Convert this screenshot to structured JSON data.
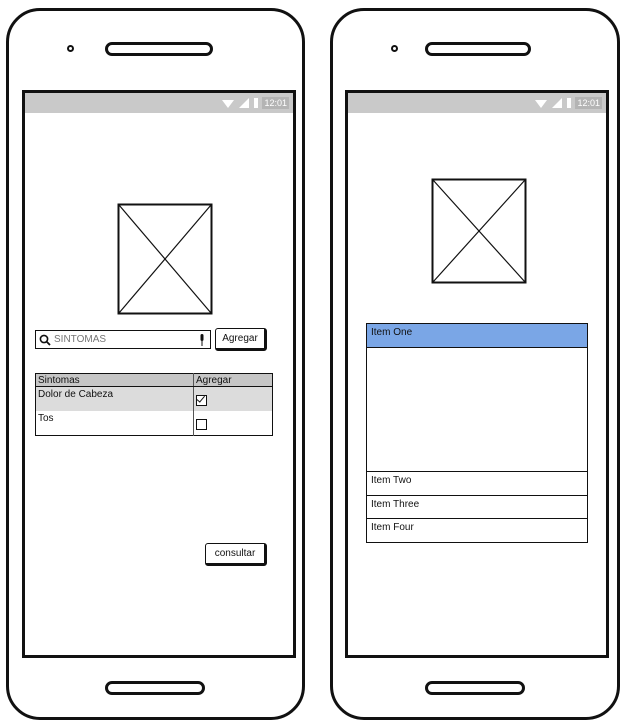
{
  "phone1": {
    "status_time": "12:01",
    "search": {
      "placeholder": "SINTOMAS",
      "value": ""
    },
    "agregar_button": "Agregar",
    "table": {
      "headers": [
        "Sintomas",
        "Agregar"
      ],
      "rows": [
        {
          "label": "Dolor de Cabeza",
          "checked": true
        },
        {
          "label": "Tos",
          "checked": false
        }
      ]
    },
    "consultar_button": "consultar"
  },
  "phone2": {
    "status_time": "12:01",
    "list": {
      "items": [
        "Item One",
        "Item Two",
        "Item Three",
        "Item Four"
      ],
      "selected_index": 0
    }
  },
  "colors": {
    "statusbar": "#c9c9c9",
    "table_header": "#c6c6c6",
    "selected_row": "#dcdcdc",
    "list_selected": "#7aa6e6"
  },
  "icons": [
    "search-icon",
    "microphone-icon",
    "wifi-icon",
    "signal-icon",
    "battery-icon",
    "image-placeholder-icon"
  ]
}
